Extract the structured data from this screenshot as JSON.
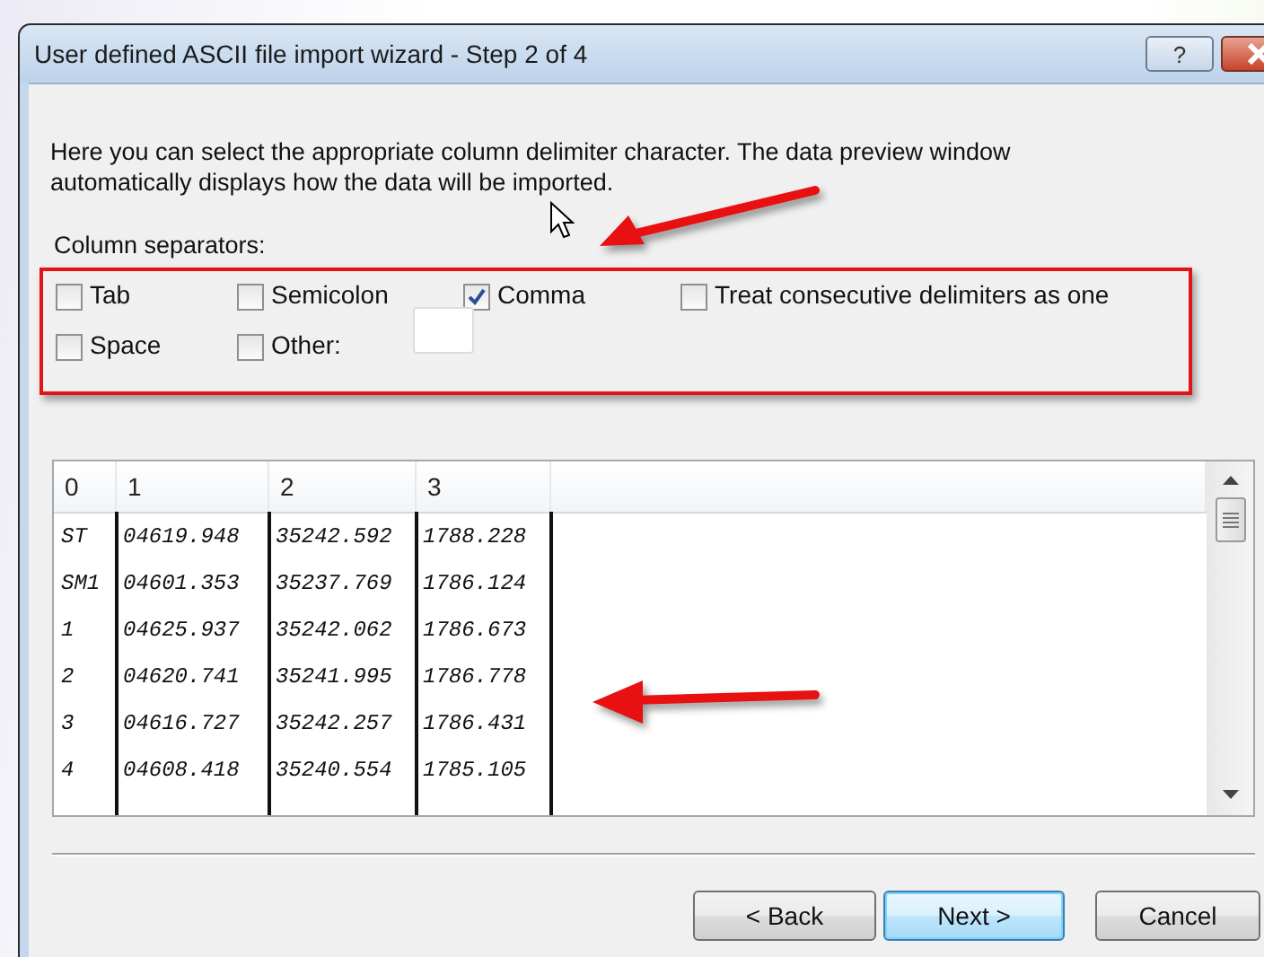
{
  "window": {
    "title": "User defined ASCII file import wizard - Step 2 of 4",
    "help_button": "?"
  },
  "description": "Here you can select the appropriate column delimiter character.  The data preview window automatically displays how the data will be imported.",
  "separators": {
    "label": "Column separators:",
    "options": [
      {
        "kind": "checkbox",
        "label": "Tab",
        "checked": false
      },
      {
        "kind": "checkbox",
        "label": "Semicolon",
        "checked": false
      },
      {
        "kind": "checkbox",
        "label": "Comma",
        "checked": true
      },
      {
        "kind": "checkbox",
        "label": "Treat consecutive delimiters as one",
        "checked": false
      },
      {
        "kind": "checkbox",
        "label": "Space",
        "checked": false
      },
      {
        "kind": "field",
        "label": "Other:",
        "checked": false
      }
    ]
  },
  "preview": {
    "columns": [
      "0",
      "1",
      "2",
      "3"
    ],
    "rows": [
      [
        "ST",
        "04619.948",
        "35242.592",
        "1788.228"
      ],
      [
        "SM1",
        "04601.353",
        "35237.769",
        "1786.124"
      ],
      [
        "1",
        "04625.937",
        "35242.062",
        "1786.673"
      ],
      [
        "2",
        "04620.741",
        "35241.995",
        "1786.778"
      ],
      [
        "3",
        "04616.727",
        "35242.257",
        "1786.431"
      ],
      [
        "4",
        "04608.418",
        "35240.554",
        "1785.105"
      ]
    ]
  },
  "buttons": [
    {
      "label": "< Back",
      "default": false
    },
    {
      "label": "Next >",
      "default": true
    },
    {
      "label": "Cancel",
      "default": false
    }
  ]
}
